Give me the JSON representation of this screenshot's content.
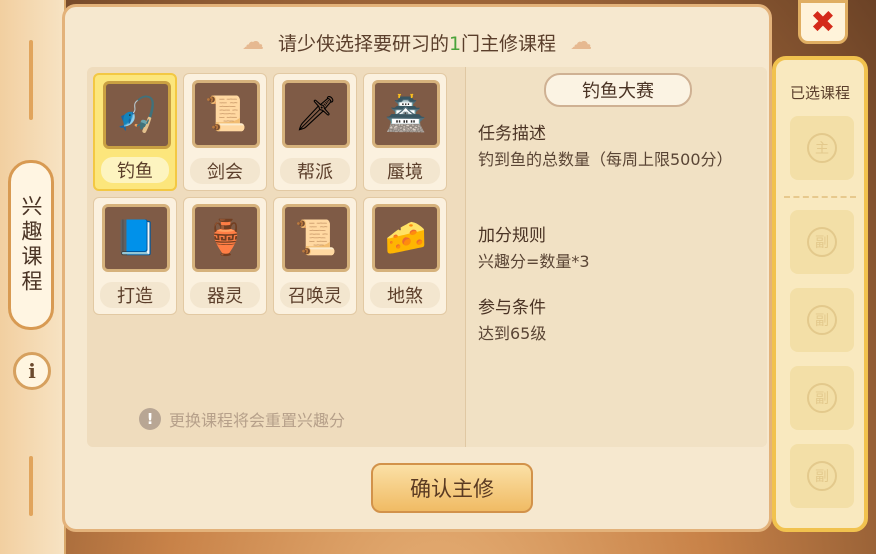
{
  "side": {
    "tab_label": "兴趣课程",
    "info_glyph": "i"
  },
  "header": {
    "prefix": "请少侠选择要研习的",
    "count": "1",
    "suffix": "门主修课程"
  },
  "courses": [
    {
      "label": "钓鱼",
      "icon": "🎣",
      "icon_name": "fishing-rod-icon",
      "selected": true
    },
    {
      "label": "剑会",
      "icon": "📜",
      "icon_name": "scroll-icon"
    },
    {
      "label": "帮派",
      "icon": "🗡",
      "icon_name": "sword-icon"
    },
    {
      "label": "蜃境",
      "icon": "🏯",
      "icon_name": "pavilion-icon"
    },
    {
      "label": "打造",
      "icon": "📘",
      "icon_name": "book-icon"
    },
    {
      "label": "器灵",
      "icon": "🏺",
      "icon_name": "jar-icon"
    },
    {
      "label": "召唤灵",
      "icon": "📜",
      "icon_name": "summon-scroll-icon"
    },
    {
      "label": "地煞",
      "icon": "🧀",
      "icon_name": "gold-ingot-icon"
    }
  ],
  "hint": {
    "icon": "!",
    "text": "更换课程将会重置兴趣分"
  },
  "detail": {
    "title": "钓鱼大赛",
    "task_label": "任务描述",
    "task_text": "钓到鱼的总数量（每周上限500分）",
    "score_label": "加分规则",
    "score_text": "兴趣分=数量*3",
    "cond_label": "参与条件",
    "cond_text": "达到65级"
  },
  "confirm_label": "确认主修",
  "selected_col": {
    "title": "已选课程",
    "slots": [
      "主",
      "副",
      "副",
      "副",
      "副"
    ]
  },
  "close_glyph": "✖"
}
